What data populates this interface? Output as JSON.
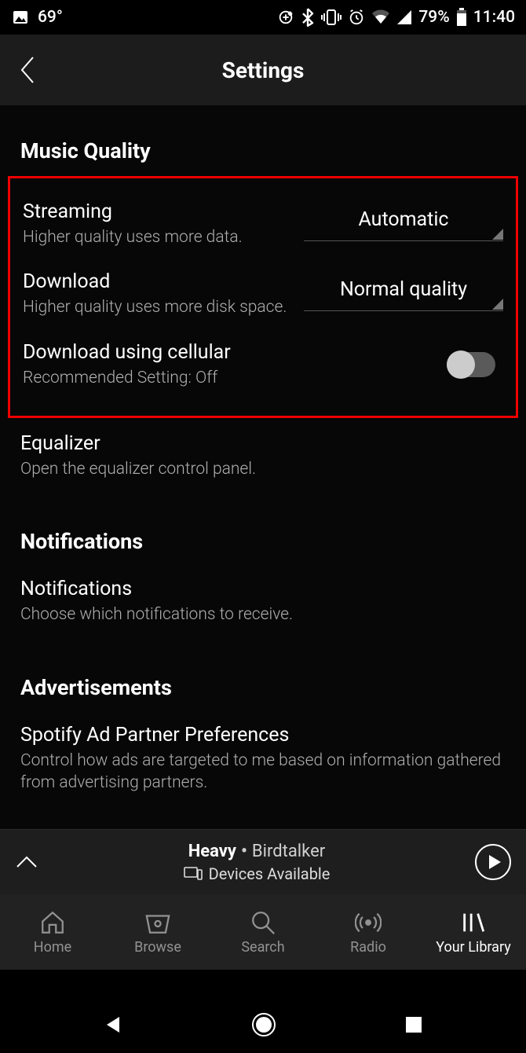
{
  "status": {
    "temp": "69°",
    "battery": "79%",
    "time": "11:40"
  },
  "header": {
    "title": "Settings"
  },
  "sections": {
    "music_quality": {
      "title": "Music Quality",
      "streaming": {
        "title": "Streaming",
        "desc": "Higher quality uses more data.",
        "value": "Automatic"
      },
      "download": {
        "title": "Download",
        "desc": "Higher quality uses more disk space.",
        "value": "Normal quality"
      },
      "cellular": {
        "title": "Download using cellular",
        "desc": "Recommended Setting: Off",
        "on": false
      },
      "equalizer": {
        "title": "Equalizer",
        "desc": "Open the equalizer control panel."
      }
    },
    "notifications": {
      "title": "Notifications",
      "item": {
        "title": "Notifications",
        "desc": "Choose which notifications to receive."
      }
    },
    "ads": {
      "title": "Advertisements",
      "item": {
        "title": "Spotify Ad Partner Preferences",
        "desc": "Control how ads are targeted to me based on information gathered from advertising partners."
      }
    }
  },
  "now_playing": {
    "song": "Heavy",
    "artist": "Birdtalker",
    "devices": "Devices Available"
  },
  "tabs": {
    "home": "Home",
    "browse": "Browse",
    "search": "Search",
    "radio": "Radio",
    "library": "Your Library"
  }
}
